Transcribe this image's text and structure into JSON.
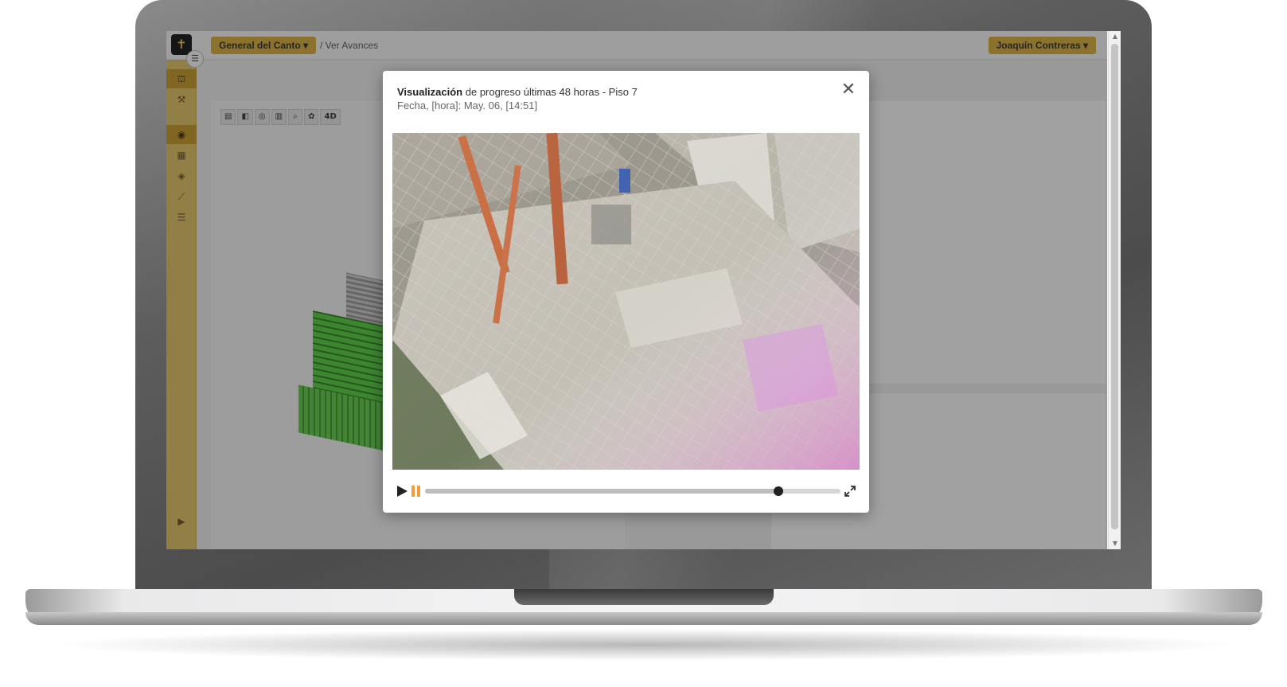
{
  "header": {
    "project_label": "General del Canto",
    "breadcrumb": "/ Ver Avances",
    "user_label": "Joaquín Contreras"
  },
  "sidebar": {
    "toggle_icon": "menu-icon",
    "items": [
      {
        "icon": "crane-icon",
        "active": true
      },
      {
        "icon": "paint-roller-icon",
        "active": false
      },
      {
        "icon": "eye-icon",
        "active": true
      },
      {
        "icon": "table-icon",
        "active": false
      },
      {
        "icon": "cube-icon",
        "active": false
      },
      {
        "icon": "line-chart-icon",
        "active": false
      },
      {
        "icon": "list-icon",
        "active": false
      }
    ],
    "footer_icon": "play-icon"
  },
  "viewer": {
    "tools": [
      "layers-icon",
      "cube-icon",
      "target-icon",
      "bar-chart-icon",
      "search-icon",
      "cluster-icon",
      "4D"
    ]
  },
  "modal": {
    "title_bold": "Visualización",
    "title_rest": " de progreso últimas 48 horas - Piso 7",
    "subtitle": "Fecha, [hora]: May. 06, [14:51]",
    "video": {
      "progress": 0.85
    }
  },
  "colors": {
    "accent": "#d9b03a",
    "sidebar": "#e3c463",
    "pause": "#f29d38"
  }
}
